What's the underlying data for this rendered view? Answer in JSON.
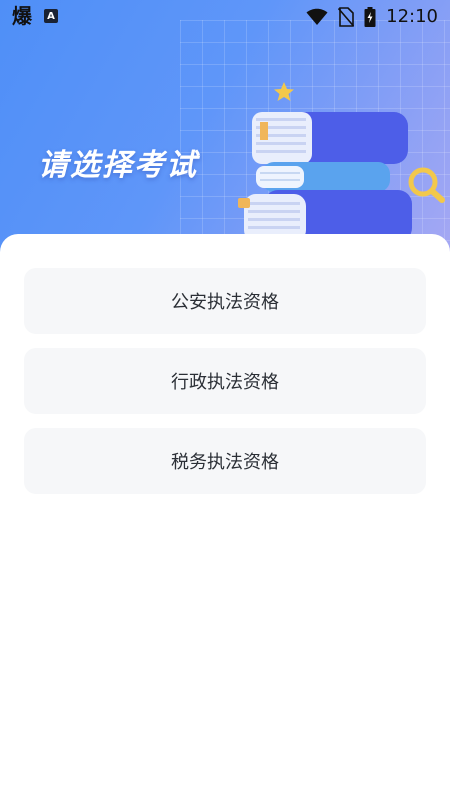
{
  "status_bar": {
    "app_glyph": "爆",
    "a_badge": "A",
    "time": "12:10",
    "icons": [
      "wifi-icon",
      "no-sim-icon",
      "battery-charging-icon"
    ]
  },
  "header": {
    "title": "请选择考试"
  },
  "exam_options": [
    {
      "label": "公安执法资格"
    },
    {
      "label": "行政执法资格"
    },
    {
      "label": "税务执法资格"
    }
  ],
  "colors": {
    "hero_gradient_start": "#4f8ff7",
    "hero_gradient_end": "#a6a8f3",
    "option_bg": "#f6f7f9",
    "option_text": "#2b2f36"
  }
}
